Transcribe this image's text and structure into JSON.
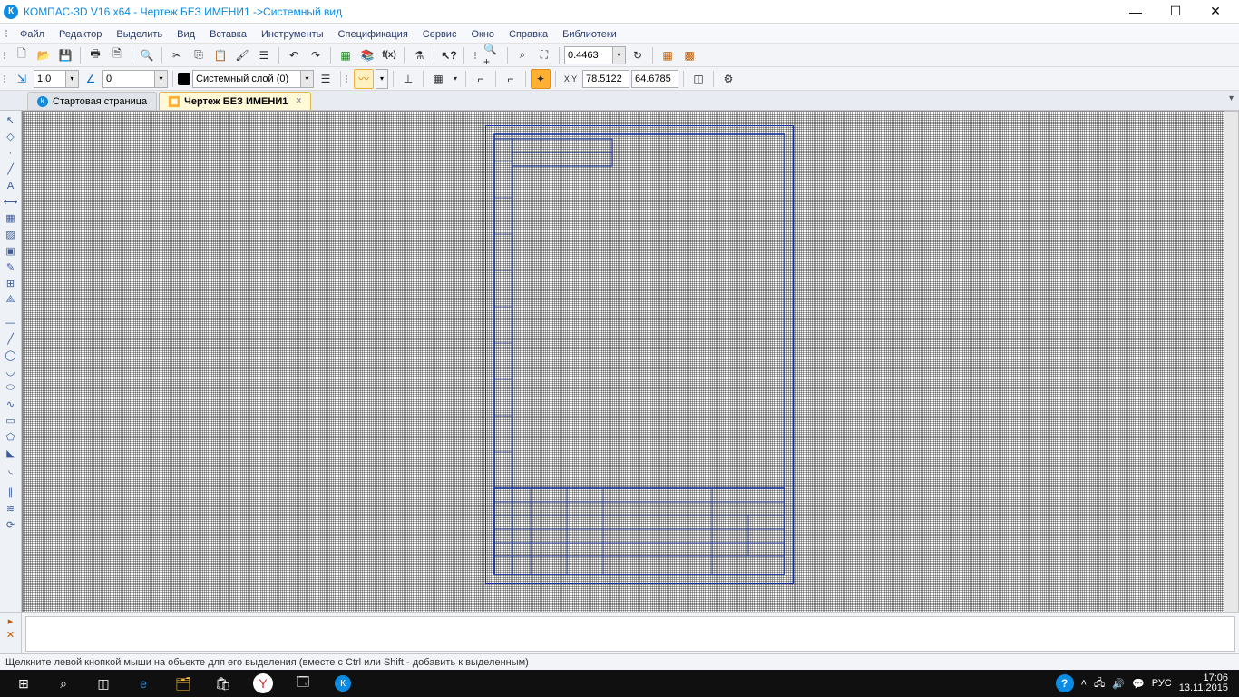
{
  "title": "КОМПАС-3D V16  x64 - Чертеж БЕЗ ИМЕНИ1 ->Системный вид",
  "menu": [
    "Файл",
    "Редактор",
    "Выделить",
    "Вид",
    "Вставка",
    "Инструменты",
    "Спецификация",
    "Сервис",
    "Окно",
    "Справка",
    "Библиотеки"
  ],
  "toolbar1": {
    "zoom_value": "0.4463"
  },
  "toolbar2": {
    "step": "1.0",
    "angle": "0",
    "layer": "Системный слой (0)",
    "coord_x": "78.5122",
    "coord_y": "64.6785"
  },
  "tabs": [
    {
      "label": "Стартовая страница",
      "active": false
    },
    {
      "label": "Чертеж БЕЗ ИМЕНИ1",
      "active": true
    }
  ],
  "status": "Щелкните левой кнопкой мыши на объекте для его выделения (вместе с Ctrl или Shift - добавить к выделенным)",
  "tray": {
    "lang": "РУС",
    "time": "17:06",
    "date": "13.11.2015"
  }
}
